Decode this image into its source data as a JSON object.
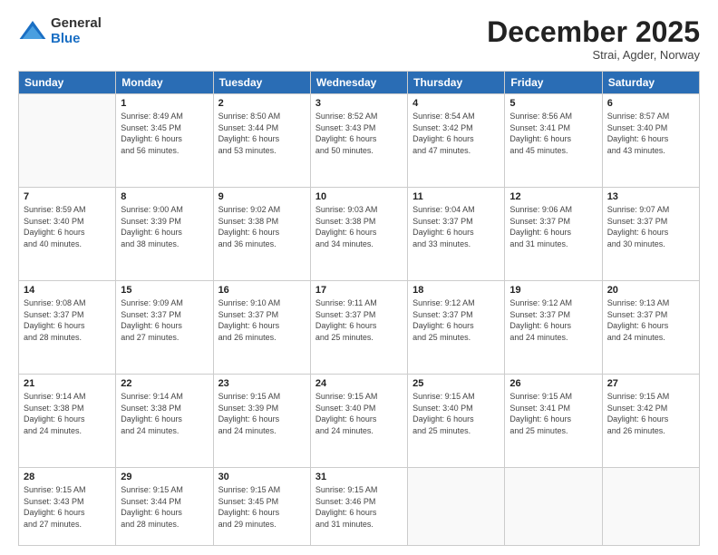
{
  "logo": {
    "general": "General",
    "blue": "Blue"
  },
  "header": {
    "month": "December 2025",
    "location": "Strai, Agder, Norway"
  },
  "weekdays": [
    "Sunday",
    "Monday",
    "Tuesday",
    "Wednesday",
    "Thursday",
    "Friday",
    "Saturday"
  ],
  "weeks": [
    [
      {
        "day": "",
        "info": ""
      },
      {
        "day": "1",
        "info": "Sunrise: 8:49 AM\nSunset: 3:45 PM\nDaylight: 6 hours\nand 56 minutes."
      },
      {
        "day": "2",
        "info": "Sunrise: 8:50 AM\nSunset: 3:44 PM\nDaylight: 6 hours\nand 53 minutes."
      },
      {
        "day": "3",
        "info": "Sunrise: 8:52 AM\nSunset: 3:43 PM\nDaylight: 6 hours\nand 50 minutes."
      },
      {
        "day": "4",
        "info": "Sunrise: 8:54 AM\nSunset: 3:42 PM\nDaylight: 6 hours\nand 47 minutes."
      },
      {
        "day": "5",
        "info": "Sunrise: 8:56 AM\nSunset: 3:41 PM\nDaylight: 6 hours\nand 45 minutes."
      },
      {
        "day": "6",
        "info": "Sunrise: 8:57 AM\nSunset: 3:40 PM\nDaylight: 6 hours\nand 43 minutes."
      }
    ],
    [
      {
        "day": "7",
        "info": "Sunrise: 8:59 AM\nSunset: 3:40 PM\nDaylight: 6 hours\nand 40 minutes."
      },
      {
        "day": "8",
        "info": "Sunrise: 9:00 AM\nSunset: 3:39 PM\nDaylight: 6 hours\nand 38 minutes."
      },
      {
        "day": "9",
        "info": "Sunrise: 9:02 AM\nSunset: 3:38 PM\nDaylight: 6 hours\nand 36 minutes."
      },
      {
        "day": "10",
        "info": "Sunrise: 9:03 AM\nSunset: 3:38 PM\nDaylight: 6 hours\nand 34 minutes."
      },
      {
        "day": "11",
        "info": "Sunrise: 9:04 AM\nSunset: 3:37 PM\nDaylight: 6 hours\nand 33 minutes."
      },
      {
        "day": "12",
        "info": "Sunrise: 9:06 AM\nSunset: 3:37 PM\nDaylight: 6 hours\nand 31 minutes."
      },
      {
        "day": "13",
        "info": "Sunrise: 9:07 AM\nSunset: 3:37 PM\nDaylight: 6 hours\nand 30 minutes."
      }
    ],
    [
      {
        "day": "14",
        "info": "Sunrise: 9:08 AM\nSunset: 3:37 PM\nDaylight: 6 hours\nand 28 minutes."
      },
      {
        "day": "15",
        "info": "Sunrise: 9:09 AM\nSunset: 3:37 PM\nDaylight: 6 hours\nand 27 minutes."
      },
      {
        "day": "16",
        "info": "Sunrise: 9:10 AM\nSunset: 3:37 PM\nDaylight: 6 hours\nand 26 minutes."
      },
      {
        "day": "17",
        "info": "Sunrise: 9:11 AM\nSunset: 3:37 PM\nDaylight: 6 hours\nand 25 minutes."
      },
      {
        "day": "18",
        "info": "Sunrise: 9:12 AM\nSunset: 3:37 PM\nDaylight: 6 hours\nand 25 minutes."
      },
      {
        "day": "19",
        "info": "Sunrise: 9:12 AM\nSunset: 3:37 PM\nDaylight: 6 hours\nand 24 minutes."
      },
      {
        "day": "20",
        "info": "Sunrise: 9:13 AM\nSunset: 3:37 PM\nDaylight: 6 hours\nand 24 minutes."
      }
    ],
    [
      {
        "day": "21",
        "info": "Sunrise: 9:14 AM\nSunset: 3:38 PM\nDaylight: 6 hours\nand 24 minutes."
      },
      {
        "day": "22",
        "info": "Sunrise: 9:14 AM\nSunset: 3:38 PM\nDaylight: 6 hours\nand 24 minutes."
      },
      {
        "day": "23",
        "info": "Sunrise: 9:15 AM\nSunset: 3:39 PM\nDaylight: 6 hours\nand 24 minutes."
      },
      {
        "day": "24",
        "info": "Sunrise: 9:15 AM\nSunset: 3:40 PM\nDaylight: 6 hours\nand 24 minutes."
      },
      {
        "day": "25",
        "info": "Sunrise: 9:15 AM\nSunset: 3:40 PM\nDaylight: 6 hours\nand 25 minutes."
      },
      {
        "day": "26",
        "info": "Sunrise: 9:15 AM\nSunset: 3:41 PM\nDaylight: 6 hours\nand 25 minutes."
      },
      {
        "day": "27",
        "info": "Sunrise: 9:15 AM\nSunset: 3:42 PM\nDaylight: 6 hours\nand 26 minutes."
      }
    ],
    [
      {
        "day": "28",
        "info": "Sunrise: 9:15 AM\nSunset: 3:43 PM\nDaylight: 6 hours\nand 27 minutes."
      },
      {
        "day": "29",
        "info": "Sunrise: 9:15 AM\nSunset: 3:44 PM\nDaylight: 6 hours\nand 28 minutes."
      },
      {
        "day": "30",
        "info": "Sunrise: 9:15 AM\nSunset: 3:45 PM\nDaylight: 6 hours\nand 29 minutes."
      },
      {
        "day": "31",
        "info": "Sunrise: 9:15 AM\nSunset: 3:46 PM\nDaylight: 6 hours\nand 31 minutes."
      },
      {
        "day": "",
        "info": ""
      },
      {
        "day": "",
        "info": ""
      },
      {
        "day": "",
        "info": ""
      }
    ]
  ]
}
